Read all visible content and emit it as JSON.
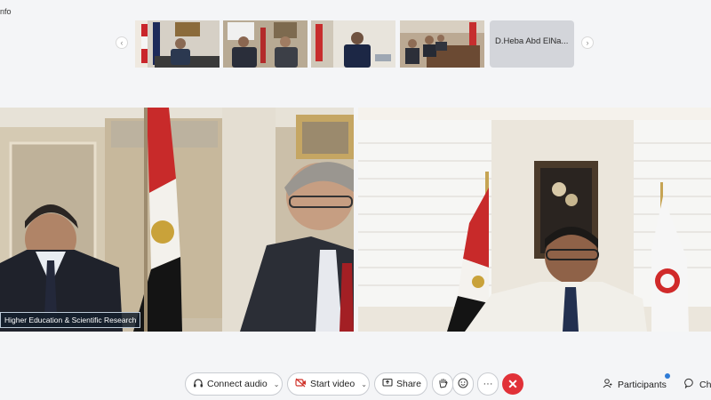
{
  "top": {
    "info_fragment": "nfo"
  },
  "thumbnails": {
    "prev_glyph": "‹",
    "next_glyph": "›",
    "name_only_tile": "D.Heba Abd ElNa..."
  },
  "main_video": {
    "left_name_label": "Higher Education & Scientific Research"
  },
  "controls": {
    "connect_audio": "Connect audio",
    "start_video": "Start video",
    "share": "Share",
    "more": "···",
    "end_glyph": "✕",
    "participants": "Participants",
    "chat": "Ch"
  },
  "colors": {
    "end_call": "#e13138",
    "badge": "#2f7bd6",
    "start_video_icon": "#d0342c"
  }
}
